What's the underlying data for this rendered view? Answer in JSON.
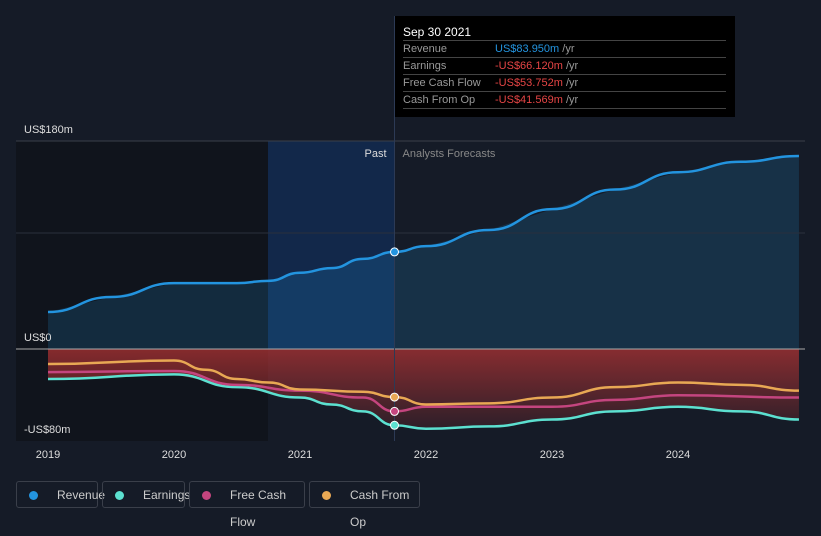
{
  "tooltip": {
    "date": "Sep 30 2021",
    "rows": [
      {
        "label": "Revenue",
        "value": "US$83.950m",
        "unit": "/yr",
        "color": "#2394df"
      },
      {
        "label": "Earnings",
        "value": "-US$66.120m",
        "unit": "/yr",
        "color": "#e64545"
      },
      {
        "label": "Free Cash Flow",
        "value": "-US$53.752m",
        "unit": "/yr",
        "color": "#e64545"
      },
      {
        "label": "Cash From Op",
        "value": "-US$41.569m",
        "unit": "/yr",
        "color": "#e64545"
      }
    ]
  },
  "chart_data": {
    "type": "line",
    "y_tick_labels": [
      "US$180m",
      "US$0",
      "-US$80m"
    ],
    "ylim": [
      -80,
      180
    ],
    "x_tick_labels": [
      "2019",
      "2020",
      "2021",
      "2022",
      "2023",
      "2024"
    ],
    "past_label": "Past",
    "forecast_label": "Analysts Forecasts",
    "divider_x": 2021.75,
    "series": [
      {
        "name": "Revenue",
        "color": "#2394df",
        "x": [
          2019,
          2019.5,
          2020,
          2020.5,
          2020.75,
          2021,
          2021.25,
          2021.5,
          2021.75,
          2022,
          2022.5,
          2023,
          2023.5,
          2024,
          2024.5,
          2024.96
        ],
        "values": [
          32,
          45,
          57,
          57,
          59,
          66,
          70,
          78,
          84,
          89,
          103,
          121,
          138,
          153,
          162,
          167
        ]
      },
      {
        "name": "Earnings",
        "color": "#5ce0d0",
        "x": [
          2019,
          2020,
          2020.5,
          2021,
          2021.25,
          2021.5,
          2021.75,
          2022,
          2022.5,
          2023,
          2023.5,
          2024,
          2024.5,
          2024.96
        ],
        "values": [
          -26,
          -22,
          -33,
          -42,
          -48,
          -54,
          -66,
          -69,
          -67,
          -61,
          -54,
          -50,
          -54,
          -61
        ]
      },
      {
        "name": "Free Cash Flow",
        "color": "#c4457f",
        "x": [
          2019,
          2020,
          2020.5,
          2021,
          2021.5,
          2021.75,
          2022,
          2022.5,
          2023,
          2023.5,
          2024,
          2024.96
        ],
        "values": [
          -20,
          -19,
          -31,
          -36,
          -42,
          -54,
          -50,
          -50,
          -50,
          -44,
          -40,
          -42
        ]
      },
      {
        "name": "Cash From Op",
        "color": "#e8a854",
        "x": [
          2019,
          2020,
          2020.25,
          2020.5,
          2020.75,
          2021,
          2021.5,
          2021.75,
          2022,
          2022.5,
          2023,
          2023.5,
          2024,
          2024.5,
          2024.96
        ],
        "values": [
          -13,
          -10,
          -18,
          -26,
          -29,
          -35,
          -37,
          -41.6,
          -48,
          -47,
          -42,
          -33,
          -29,
          -31,
          -36
        ]
      }
    ]
  }
}
